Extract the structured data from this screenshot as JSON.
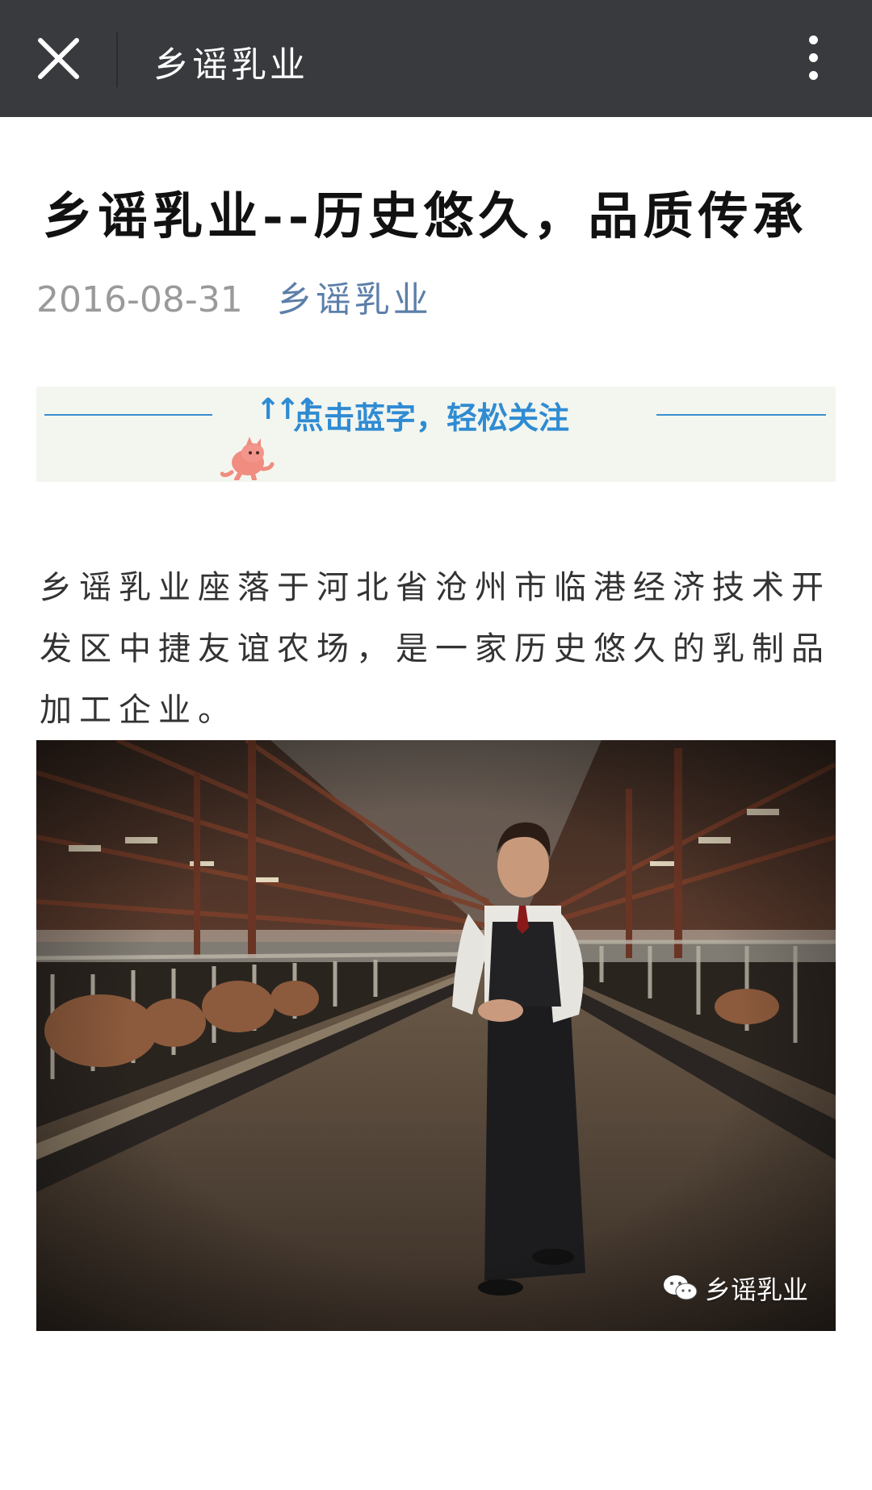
{
  "topbar": {
    "title": "乡谣乳业",
    "close_icon": "close-icon",
    "more_icon": "more-vertical-icon"
  },
  "article": {
    "title": "乡谣乳业--历史悠久，品质传承",
    "date": "2016-08-31",
    "author": "乡谣乳业",
    "follow_banner": {
      "arrows": "↑↑↑",
      "text": "点击蓝字，轻松关注"
    },
    "body": "乡谣乳业座落于河北省沧州市临港经济技术开发区中捷友谊农场，是一家历史悠久的乳制品加工企业。",
    "image": {
      "description_icon": "barn-photo",
      "watermark": "乡谣乳业"
    }
  },
  "colors": {
    "topbar_bg": "#393a3e",
    "author_link": "#5c7fa9",
    "follow_blue": "#2f8bd3"
  }
}
